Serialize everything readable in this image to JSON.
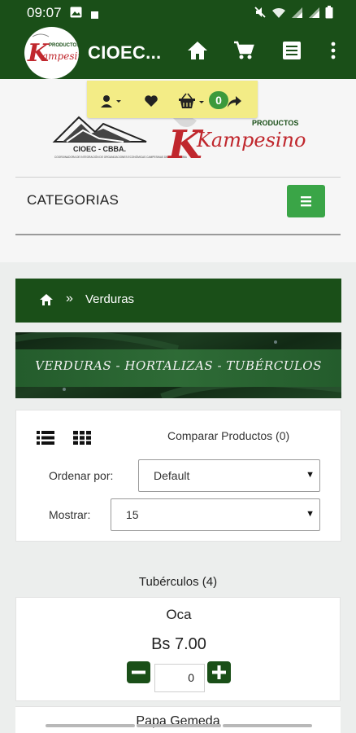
{
  "status_bar": {
    "time": "09:07",
    "icons": [
      "image-icon",
      "square-icon",
      "mute-icon",
      "wifi-icon",
      "signal-icon",
      "signal-icon",
      "battery-icon"
    ]
  },
  "app_bar": {
    "title": "CIOEC...",
    "logo_small_text": "PRODUCTOS",
    "logo_text": "Kampesino",
    "actions": [
      "home-icon",
      "cart-icon",
      "list-icon",
      "more-vert-icon"
    ]
  },
  "quick_toolbar": {
    "cart_count": "0",
    "icons": [
      "user-icon",
      "heart-icon",
      "basket-icon",
      "share-icon"
    ]
  },
  "brand": {
    "cioec_label": "CIOEC - CBBA.",
    "cioec_subline": "COORDINADORA DE INTEGRACIÓN DE ORGANIZACIONES ECONÓMICAS CAMPESINAS DE COCHABAMBA",
    "products_label": "PRODUCTOS",
    "kampesino": "Kampesino"
  },
  "categories": {
    "title": "CATEGORIAS"
  },
  "breadcrumb": {
    "separator": "»",
    "current": "Verduras"
  },
  "banner": {
    "text": "VERDURAS - HORTALIZAS - TUBÉRCULOS"
  },
  "controls": {
    "compare": "Comparar Productos (0)",
    "order_label": "Ordenar por:",
    "order_value": "Default",
    "show_label": "Mostrar:",
    "show_value": "15"
  },
  "subcategory": {
    "title": "Tubérculos (4)"
  },
  "product": {
    "name": "Oca",
    "price": "Bs 7.00",
    "quantity": "0"
  },
  "next_product": {
    "name": "Papa Gemeda"
  },
  "colors": {
    "primary_green": "#1a4f18",
    "button_green": "#3aa547",
    "toolbar_yellow": "#f3ec86",
    "brand_red": "#c0272d"
  }
}
